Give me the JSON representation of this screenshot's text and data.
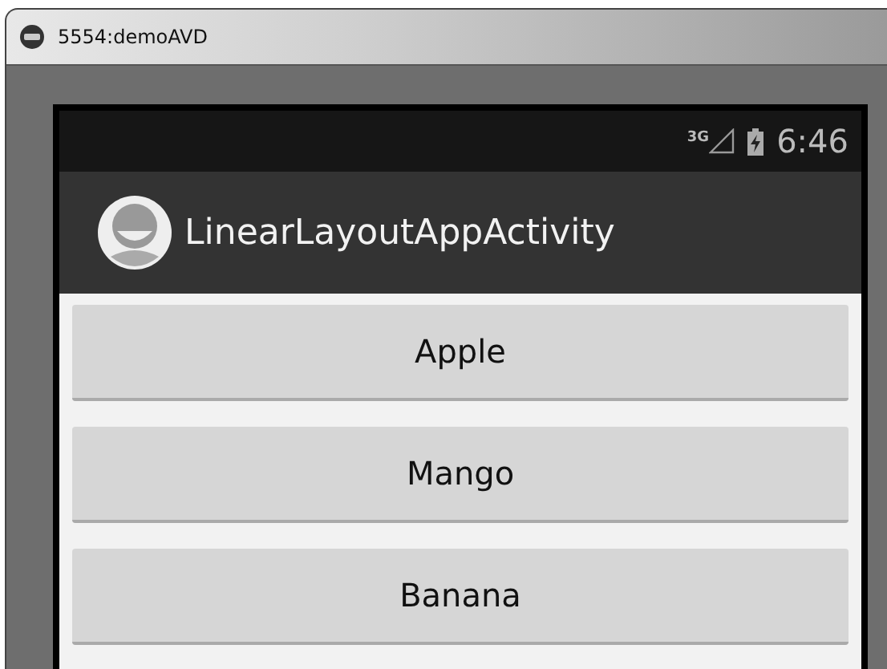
{
  "window": {
    "title": "5554:demoAVD"
  },
  "status_bar": {
    "network": "3G",
    "time": "6:46"
  },
  "action_bar": {
    "title": "LinearLayoutAppActivity"
  },
  "buttons": [
    {
      "label": "Apple"
    },
    {
      "label": "Mango"
    },
    {
      "label": "Banana"
    }
  ]
}
